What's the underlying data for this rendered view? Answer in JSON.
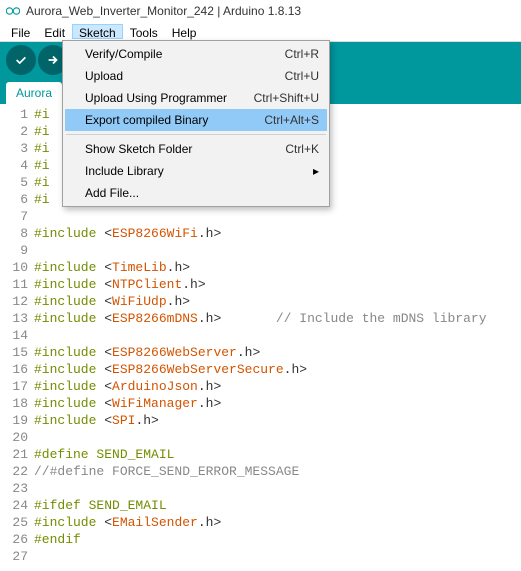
{
  "window": {
    "title": "Aurora_Web_Inverter_Monitor_242 | Arduino 1.8.13"
  },
  "menubar": [
    "File",
    "Edit",
    "Sketch",
    "Tools",
    "Help"
  ],
  "open_menu_index": 2,
  "tab": {
    "label": "Aurora"
  },
  "dropdown": {
    "items": [
      {
        "label": "Verify/Compile",
        "shortcut": "Ctrl+R"
      },
      {
        "label": "Upload",
        "shortcut": "Ctrl+U"
      },
      {
        "label": "Upload Using Programmer",
        "shortcut": "Ctrl+Shift+U"
      },
      {
        "label": "Export compiled Binary",
        "shortcut": "Ctrl+Alt+S",
        "highlight": true
      },
      {
        "sep": true
      },
      {
        "label": "Show Sketch Folder",
        "shortcut": "Ctrl+K"
      },
      {
        "label": "Include Library",
        "submenu": true
      },
      {
        "label": "Add File..."
      }
    ]
  },
  "code_lines": [
    {
      "n": 1,
      "pre": "#i"
    },
    {
      "n": 2,
      "pre": "#i"
    },
    {
      "n": 3,
      "pre": "#i"
    },
    {
      "n": 4,
      "pre": "#i"
    },
    {
      "n": 5,
      "pre": "#i"
    },
    {
      "n": 6,
      "pre": "#i"
    },
    {
      "n": 7,
      "pre": ""
    },
    {
      "n": 8,
      "pre": "#include ",
      "br": "<",
      "inc": "ESP8266WiFi",
      "suf": ".h>"
    },
    {
      "n": 9,
      "pre": ""
    },
    {
      "n": 10,
      "pre": "#include ",
      "br": "<",
      "inc": "TimeLib",
      "suf": ".h>"
    },
    {
      "n": 11,
      "pre": "#include ",
      "br": "<",
      "inc": "NTPClient",
      "suf": ".h>"
    },
    {
      "n": 12,
      "pre": "#include ",
      "br": "<",
      "inc": "WiFiUdp",
      "suf": ".h>"
    },
    {
      "n": 13,
      "pre": "#include ",
      "br": "<",
      "inc": "ESP8266mDNS",
      "suf": ".h>       ",
      "cmt": "// Include the mDNS library"
    },
    {
      "n": 14,
      "pre": ""
    },
    {
      "n": 15,
      "pre": "#include ",
      "br": "<",
      "inc": "ESP8266WebServer",
      "suf": ".h>"
    },
    {
      "n": 16,
      "pre": "#include ",
      "br": "<",
      "inc": "ESP8266WebServerSecure",
      "suf": ".h>"
    },
    {
      "n": 17,
      "pre": "#include ",
      "br": "<",
      "inc": "ArduinoJson",
      "suf": ".h>"
    },
    {
      "n": 18,
      "pre": "#include ",
      "br": "<",
      "inc": "WiFiManager",
      "suf": ".h>"
    },
    {
      "n": 19,
      "pre": "#include ",
      "br": "<",
      "inc": "SPI",
      "suf": ".h>"
    },
    {
      "n": 20,
      "pre": ""
    },
    {
      "n": 21,
      "pre": "#define SEND_EMAIL"
    },
    {
      "n": 22,
      "cmt": "//#define FORCE_SEND_ERROR_MESSAGE"
    },
    {
      "n": 23,
      "pre": ""
    },
    {
      "n": 24,
      "pre": "#ifdef SEND_EMAIL"
    },
    {
      "n": 25,
      "pre": "#include ",
      "br": "<",
      "inc": "EMailSender",
      "suf": ".h>"
    },
    {
      "n": 26,
      "pre": "#endif"
    },
    {
      "n": 27,
      "pre": ""
    }
  ]
}
